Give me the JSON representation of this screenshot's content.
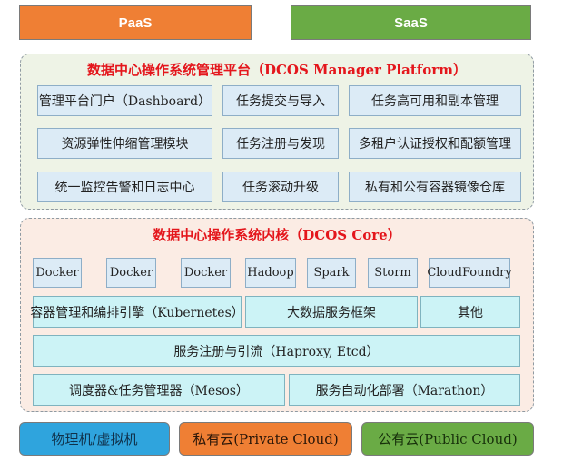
{
  "top": {
    "paas": "PaaS",
    "saas": "SaaS"
  },
  "manager": {
    "title": "数据中心操作系统管理平台（DCOS Manager Platform）",
    "items": [
      "管理平台门户（Dashboard）",
      "任务提交与导入",
      "任务高可用和副本管理",
      "资源弹性伸缩管理模块",
      "任务注册与发现",
      "多租户认证授权和配额管理",
      "统一监控告警和日志中心",
      "任务滚动升级",
      "私有和公有容器镜像仓库"
    ]
  },
  "core": {
    "title": "数据中心操作系统内核（DCOS Core）",
    "chips": [
      "Docker",
      "Docker",
      "Docker",
      "Hadoop",
      "Spark",
      "Storm",
      "CloudFoundry"
    ],
    "kubernetes": "容器管理和编排引擎（Kubernetes）",
    "bigdata": "大数据服务框架",
    "other": "其他",
    "registry": "服务注册与引流（Haproxy, Etcd）",
    "mesos": "调度器&任务管理器（Mesos）",
    "marathon": "服务自动化部署（Marathon）"
  },
  "bottom": {
    "physical": "物理机/虚拟机",
    "private": "私有云(Private Cloud)",
    "public": "公有云(Public Cloud)"
  }
}
